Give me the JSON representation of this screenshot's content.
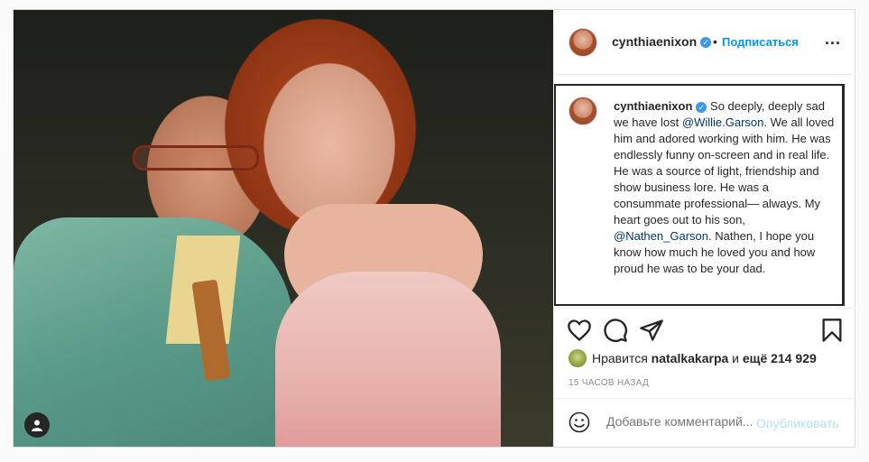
{
  "post": {
    "username": "cynthiaenixon",
    "follow_separator": "•",
    "follow_label": "Подписаться",
    "more_icon": "...",
    "verified_icon": "✓",
    "caption": {
      "username": "cynthiaenixon",
      "text_1": "So deeply, deeply sad we have lost ",
      "mention_1": "@Willie.Garson",
      "text_2": ". We all loved him and adored working with him. He was endlessly funny on-screen and in real life. He was a source of light, friendship and show business lore. He was a consummate professional— always. My heart goes out to his son, ",
      "mention_2": "@Nathen_Garson",
      "text_3": ". Nathen, I hope you know how much he loved you and how proud he was to be your dad."
    },
    "likes": {
      "prefix": "Нравится",
      "liker": "natalkakarpa",
      "middle": "и",
      "count_text": "ещё 214 929"
    },
    "time_ago": "15 ЧАСОВ НАЗАД",
    "comment": {
      "placeholder": "Добавьте комментарий...",
      "publish_label": "Опубликовать"
    },
    "icons": [
      "heart-icon",
      "comment-icon",
      "share-icon",
      "bookmark-icon",
      "emoji-icon",
      "user-tag-icon"
    ]
  }
}
